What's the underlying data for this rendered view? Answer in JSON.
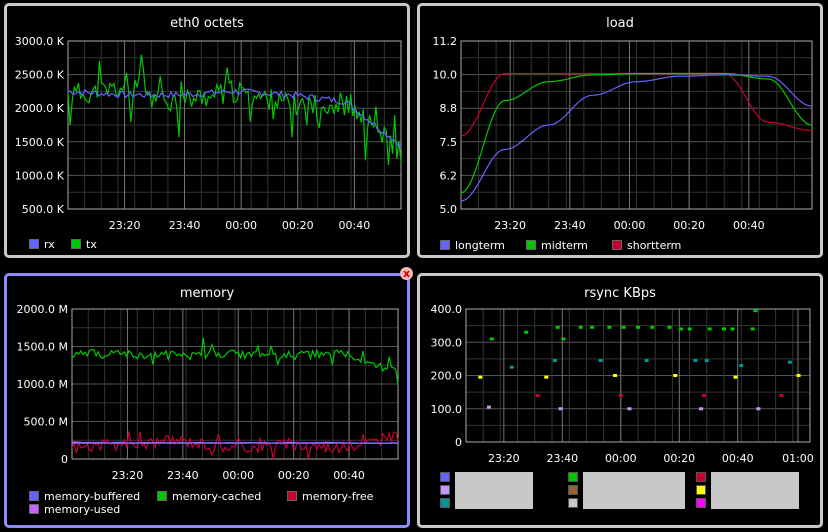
{
  "panels": {
    "eth0": {
      "title": "eth0 octets",
      "legend": [
        {
          "label": "rx",
          "color": "#6464ff"
        },
        {
          "label": "tx",
          "color": "#00c800"
        }
      ]
    },
    "load": {
      "title": "load",
      "legend": [
        {
          "label": "longterm",
          "color": "#6464ff"
        },
        {
          "label": "midterm",
          "color": "#00c800"
        },
        {
          "label": "shortterm",
          "color": "#c8002a"
        }
      ]
    },
    "memory": {
      "title": "memory",
      "close_label": "x",
      "legend": [
        {
          "label": "memory-buffered",
          "color": "#6464ff"
        },
        {
          "label": "memory-cached",
          "color": "#00c800"
        },
        {
          "label": "memory-free",
          "color": "#c8002a"
        },
        {
          "label": "memory-used",
          "color": "#c864ff"
        }
      ]
    },
    "rsync": {
      "title": "rsync KBps",
      "legend_colors": [
        "#6464ff",
        "#c896ff",
        "#009696",
        "#00c800",
        "#966432",
        "#c8c8c8",
        "#c8002a",
        "#ffff00",
        "#ff00ff"
      ]
    }
  },
  "chart_data": [
    {
      "type": "line",
      "title": "eth0 octets",
      "x": [
        "23:00",
        "23:20",
        "23:40",
        "00:00",
        "00:20",
        "00:40",
        "00:55"
      ],
      "x_ticks": [
        "23:20",
        "23:40",
        "00:00",
        "00:20",
        "00:40"
      ],
      "y_ticks": [
        "500.0 K",
        "1000.0 K",
        "1500.0 K",
        "2000.0 K",
        "2500.0 K",
        "3000.0 K"
      ],
      "ylim": [
        500,
        3000
      ],
      "y_unit": "K",
      "grid": true,
      "legend_position": "bottom",
      "series": [
        {
          "name": "rx",
          "values": [
            2250,
            2200,
            2200,
            2250,
            2200,
            2100,
            1450
          ]
        },
        {
          "name": "tx",
          "values": [
            2200,
            2300,
            2100,
            2250,
            2050,
            2050,
            1350
          ]
        }
      ]
    },
    {
      "type": "line",
      "title": "load",
      "x": [
        "22:55",
        "23:10",
        "23:20",
        "23:40",
        "00:00",
        "00:20",
        "00:40",
        "00:45",
        "00:55"
      ],
      "x_ticks": [
        "23:20",
        "23:40",
        "00:00",
        "00:20",
        "00:40"
      ],
      "y_ticks": [
        "5.0",
        "6.2",
        "7.5",
        "8.8",
        "10.0",
        "11.2"
      ],
      "ylim": [
        5.0,
        11.2
      ],
      "grid": true,
      "legend_position": "bottom",
      "series": [
        {
          "name": "longterm",
          "values": [
            5.3,
            7.2,
            8.1,
            9.2,
            9.7,
            9.9,
            9.95,
            9.9,
            8.8
          ]
        },
        {
          "name": "midterm",
          "values": [
            5.6,
            9.0,
            9.7,
            9.95,
            10.0,
            10.0,
            10.0,
            9.8,
            8.1
          ]
        },
        {
          "name": "shortterm",
          "values": [
            7.7,
            10.0,
            10.0,
            10.0,
            10.0,
            10.0,
            10.0,
            8.2,
            7.9
          ]
        }
      ]
    },
    {
      "type": "line",
      "title": "memory",
      "x": [
        "23:00",
        "23:20",
        "23:40",
        "00:00",
        "00:20",
        "00:40",
        "00:55"
      ],
      "x_ticks": [
        "23:20",
        "23:40",
        "00:00",
        "00:20",
        "00:40"
      ],
      "y_ticks": [
        "0",
        "500.0 M",
        "1000.0 M",
        "1500.0 M",
        "2000.0 M"
      ],
      "ylim": [
        0,
        2000
      ],
      "y_unit": "M",
      "grid": true,
      "legend_position": "bottom",
      "series": [
        {
          "name": "memory-buffered",
          "values": [
            210,
            210,
            210,
            210,
            210,
            210,
            210
          ]
        },
        {
          "name": "memory-cached",
          "values": [
            1400,
            1400,
            1380,
            1400,
            1380,
            1400,
            1150
          ]
        },
        {
          "name": "memory-free",
          "values": [
            150,
            200,
            250,
            150,
            200,
            150,
            300
          ]
        },
        {
          "name": "memory-used",
          "values": [
            220,
            215,
            215,
            215,
            215,
            215,
            210
          ]
        }
      ]
    },
    {
      "type": "scatter",
      "title": "rsync KBps",
      "x_ticks": [
        "23:20",
        "23:40",
        "00:00",
        "00:20",
        "00:40",
        "01:00"
      ],
      "y_ticks": [
        "0",
        "100.0",
        "200.0",
        "300.0",
        "400.0"
      ],
      "ylim": [
        0,
        400
      ],
      "grid": true,
      "legend_position": "bottom",
      "points": [
        {
          "x": 0.05,
          "y": 195,
          "color": "#ffff00"
        },
        {
          "x": 0.08,
          "y": 105,
          "color": "#c896ff"
        },
        {
          "x": 0.09,
          "y": 310,
          "color": "#00c800"
        },
        {
          "x": 0.16,
          "y": 225,
          "color": "#009696"
        },
        {
          "x": 0.21,
          "y": 330,
          "color": "#00c800"
        },
        {
          "x": 0.25,
          "y": 140,
          "color": "#c8002a"
        },
        {
          "x": 0.28,
          "y": 195,
          "color": "#ffff00"
        },
        {
          "x": 0.31,
          "y": 245,
          "color": "#009696"
        },
        {
          "x": 0.32,
          "y": 345,
          "color": "#00c800"
        },
        {
          "x": 0.33,
          "y": 100,
          "color": "#c896ff"
        },
        {
          "x": 0.34,
          "y": 310,
          "color": "#00c800"
        },
        {
          "x": 0.4,
          "y": 345,
          "color": "#00c800"
        },
        {
          "x": 0.44,
          "y": 345,
          "color": "#00c800"
        },
        {
          "x": 0.47,
          "y": 245,
          "color": "#009696"
        },
        {
          "x": 0.5,
          "y": 345,
          "color": "#00c800"
        },
        {
          "x": 0.52,
          "y": 200,
          "color": "#ffff00"
        },
        {
          "x": 0.54,
          "y": 140,
          "color": "#c8002a"
        },
        {
          "x": 0.55,
          "y": 345,
          "color": "#00c800"
        },
        {
          "x": 0.57,
          "y": 100,
          "color": "#c896ff"
        },
        {
          "x": 0.6,
          "y": 345,
          "color": "#00c800"
        },
        {
          "x": 0.63,
          "y": 245,
          "color": "#009696"
        },
        {
          "x": 0.65,
          "y": 345,
          "color": "#00c800"
        },
        {
          "x": 0.71,
          "y": 345,
          "color": "#00c800"
        },
        {
          "x": 0.73,
          "y": 200,
          "color": "#ffff00"
        },
        {
          "x": 0.75,
          "y": 340,
          "color": "#00c800"
        },
        {
          "x": 0.78,
          "y": 340,
          "color": "#00c800"
        },
        {
          "x": 0.8,
          "y": 245,
          "color": "#009696"
        },
        {
          "x": 0.82,
          "y": 100,
          "color": "#c896ff"
        },
        {
          "x": 0.83,
          "y": 140,
          "color": "#c8002a"
        },
        {
          "x": 0.84,
          "y": 245,
          "color": "#009696"
        },
        {
          "x": 0.85,
          "y": 340,
          "color": "#00c800"
        },
        {
          "x": 0.9,
          "y": 340,
          "color": "#00c800"
        },
        {
          "x": 0.93,
          "y": 340,
          "color": "#00c800"
        },
        {
          "x": 0.94,
          "y": 195,
          "color": "#ffff00"
        },
        {
          "x": 0.96,
          "y": 230,
          "color": "#009696"
        },
        {
          "x": 1.0,
          "y": 340,
          "color": "#00c800"
        },
        {
          "x": 1.01,
          "y": 395,
          "color": "#00c800"
        },
        {
          "x": 1.02,
          "y": 100,
          "color": "#c896ff"
        },
        {
          "x": 1.1,
          "y": 140,
          "color": "#c8002a"
        },
        {
          "x": 1.13,
          "y": 240,
          "color": "#009696"
        },
        {
          "x": 1.16,
          "y": 200,
          "color": "#ffff00"
        }
      ]
    }
  ]
}
